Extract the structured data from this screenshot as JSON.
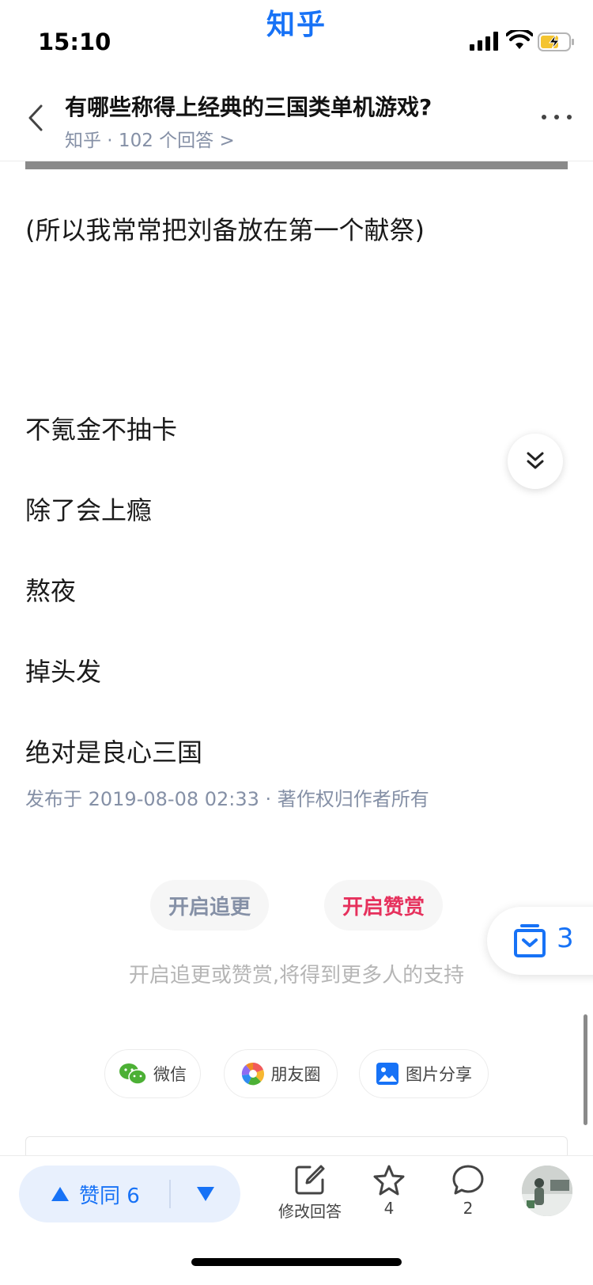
{
  "status_bar": {
    "carrier": "知乎",
    "time": "15:10"
  },
  "header": {
    "title": "有哪些称得上经典的三国类单机游戏?",
    "meta": "知乎 · 102 个回答 >"
  },
  "article": {
    "paragraphs": [
      "(所以我常常把刘备放在第一个献祭)",
      "不氪金不抽卡",
      "除了会上瘾",
      "熬夜",
      "掉头发",
      "绝对是良心三国"
    ],
    "published": "发布于 2019-08-08 02:33 · 著作权归作者所有"
  },
  "actions": {
    "follow_label": "开启追更",
    "reward_label": "开启赞赏",
    "hint": "开启追更或赞赏,将得到更多人的支持"
  },
  "collect_float": {
    "count": "3"
  },
  "share": {
    "wechat": "微信",
    "moments": "朋友圈",
    "image": "图片分享"
  },
  "bottom_bar": {
    "vote_label": "赞同 6",
    "edit_label": "修改回答",
    "star_count": "4",
    "comment_count": "2"
  },
  "colors": {
    "brand_blue": "#1772f6",
    "reward_red": "#e6305c",
    "meta_gray": "#8590a6"
  }
}
